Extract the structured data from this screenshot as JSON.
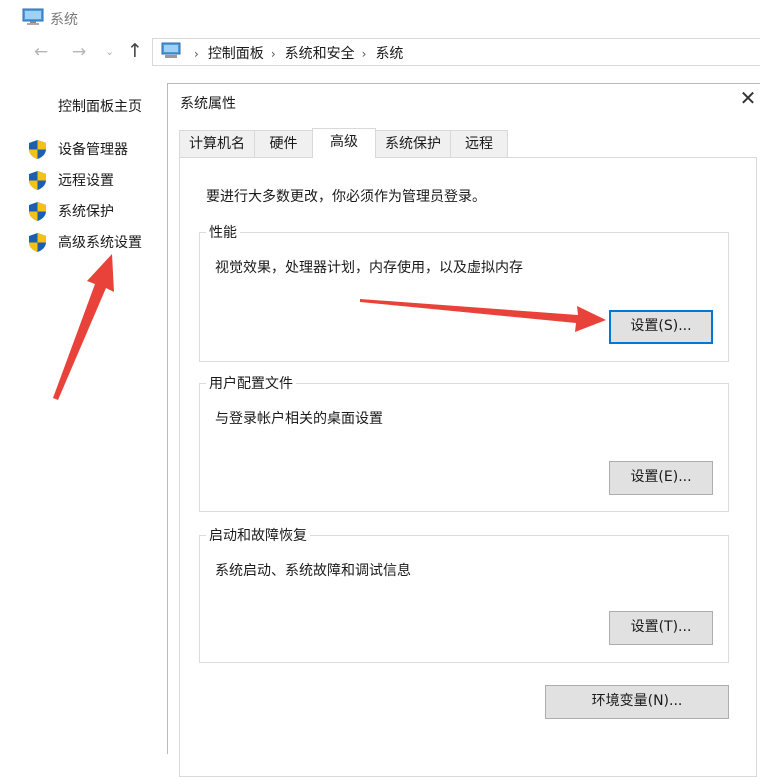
{
  "window": {
    "title": "系统",
    "icon": "system-monitor-icon"
  },
  "nav": {
    "back_glyph": "←",
    "forward_glyph": "→",
    "recent_glyph": "⌄",
    "up_glyph": "↑",
    "breadcrumb": [
      "控制面板",
      "系统和安全",
      "系统"
    ],
    "separator": "›"
  },
  "sidebar": {
    "home": "控制面板主页",
    "items": [
      {
        "label": "设备管理器",
        "icon": "uac-shield-icon"
      },
      {
        "label": "远程设置",
        "icon": "uac-shield-icon"
      },
      {
        "label": "系统保护",
        "icon": "uac-shield-icon"
      },
      {
        "label": "高级系统设置",
        "icon": "uac-shield-icon"
      }
    ]
  },
  "dialog": {
    "title": "系统属性",
    "close_glyph": "✕",
    "tabs": [
      {
        "label": "计算机名",
        "active": false
      },
      {
        "label": "硬件",
        "active": false
      },
      {
        "label": "高级",
        "active": true
      },
      {
        "label": "系统保护",
        "active": false
      },
      {
        "label": "远程",
        "active": false
      }
    ],
    "admin_note": "要进行大多数更改，你必须作为管理员登录。",
    "groups": [
      {
        "title": "性能",
        "description": "视觉效果，处理器计划，内存使用，以及虚拟内存",
        "button": "设置(S)..."
      },
      {
        "title": "用户配置文件",
        "description": "与登录帐户相关的桌面设置",
        "button": "设置(E)..."
      },
      {
        "title": "启动和故障恢复",
        "description": "系统启动、系统故障和调试信息",
        "button": "设置(T)..."
      }
    ],
    "env_button": "环境变量(N)..."
  },
  "colors": {
    "focus": "#0078d7",
    "annotation_arrow": "#e8423a",
    "shield_blue": "#1a5fb4",
    "shield_yellow": "#f5c211"
  }
}
